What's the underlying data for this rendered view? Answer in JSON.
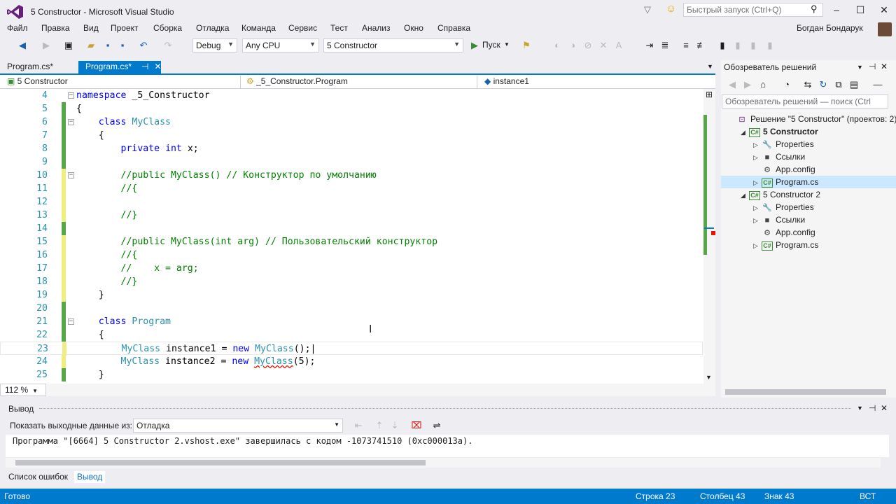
{
  "window": {
    "title": "5 Constructor - Microsoft Visual Studio",
    "quick_launch_placeholder": "Быстрый запуск (Ctrl+Q)",
    "user": "Богдан Бондарук"
  },
  "menu": [
    "Файл",
    "Правка",
    "Вид",
    "Проект",
    "Сборка",
    "Отладка",
    "Команда",
    "Сервис",
    "Тест",
    "Анализ",
    "Окно",
    "Справка"
  ],
  "toolbar": {
    "config": "Debug",
    "platform": "Any CPU",
    "startup_project": "5 Constructor",
    "run_label": "Пуск"
  },
  "tabs": [
    "Program.cs*",
    "Program.cs*"
  ],
  "navbar": {
    "project": "5 Constructor",
    "class": "_5_Constructor.Program",
    "member": "instance1"
  },
  "editor": {
    "zoom": "112 %",
    "lines": [
      {
        "n": "4",
        "parts": [
          [
            "kw",
            "namespace"
          ],
          [
            "p",
            " _5_Constructor"
          ]
        ]
      },
      {
        "n": "5",
        "parts": [
          [
            "p",
            "{"
          ]
        ]
      },
      {
        "n": "6",
        "parts": [
          [
            "p",
            "    "
          ],
          [
            "kw",
            "class"
          ],
          [
            "p",
            " "
          ],
          [
            "ty",
            "MyClass"
          ]
        ]
      },
      {
        "n": "7",
        "parts": [
          [
            "p",
            "    {"
          ]
        ]
      },
      {
        "n": "8",
        "parts": [
          [
            "p",
            "        "
          ],
          [
            "kw",
            "private"
          ],
          [
            "p",
            " "
          ],
          [
            "kw",
            "int"
          ],
          [
            "p",
            " x;"
          ]
        ]
      },
      {
        "n": "9",
        "parts": [
          [
            "p",
            ""
          ]
        ]
      },
      {
        "n": "10",
        "parts": [
          [
            "p",
            "        "
          ],
          [
            "cm",
            "//public MyClass() // Конструктор по умолчанию"
          ]
        ]
      },
      {
        "n": "11",
        "parts": [
          [
            "p",
            "        "
          ],
          [
            "cm",
            "//{"
          ]
        ]
      },
      {
        "n": "12",
        "parts": [
          [
            "p",
            ""
          ]
        ]
      },
      {
        "n": "13",
        "parts": [
          [
            "p",
            "        "
          ],
          [
            "cm",
            "//}"
          ]
        ]
      },
      {
        "n": "14",
        "parts": [
          [
            "p",
            ""
          ]
        ]
      },
      {
        "n": "15",
        "parts": [
          [
            "p",
            "        "
          ],
          [
            "cm",
            "//public MyClass(int arg) // Пользовательский конструктор"
          ]
        ]
      },
      {
        "n": "16",
        "parts": [
          [
            "p",
            "        "
          ],
          [
            "cm",
            "//{"
          ]
        ]
      },
      {
        "n": "17",
        "parts": [
          [
            "p",
            "        "
          ],
          [
            "cm",
            "//    x = arg;"
          ]
        ]
      },
      {
        "n": "18",
        "parts": [
          [
            "p",
            "        "
          ],
          [
            "cm",
            "//}"
          ]
        ]
      },
      {
        "n": "19",
        "parts": [
          [
            "p",
            "    }"
          ]
        ]
      },
      {
        "n": "20",
        "parts": [
          [
            "p",
            ""
          ]
        ]
      },
      {
        "n": "21",
        "parts": [
          [
            "p",
            "    "
          ],
          [
            "kw",
            "class"
          ],
          [
            "p",
            " "
          ],
          [
            "ty",
            "Program"
          ]
        ]
      },
      {
        "n": "22",
        "parts": [
          [
            "p",
            "    {"
          ]
        ]
      },
      {
        "n": "23",
        "parts": [
          [
            "p",
            "        "
          ],
          [
            "ty",
            "MyClass"
          ],
          [
            "p",
            " instance1 = "
          ],
          [
            "kw",
            "new"
          ],
          [
            "p",
            " "
          ],
          [
            "ty",
            "MyClass"
          ],
          [
            "p",
            "();|"
          ]
        ]
      },
      {
        "n": "24",
        "parts": [
          [
            "p",
            "        "
          ],
          [
            "ty",
            "MyClass"
          ],
          [
            "p",
            " instance2 = "
          ],
          [
            "kw",
            "new"
          ],
          [
            "p",
            " "
          ],
          [
            "ty",
            "MyClass"
          ],
          [
            "p",
            "(5);"
          ]
        ]
      },
      {
        "n": "25",
        "parts": [
          [
            "p",
            "    }"
          ]
        ]
      }
    ]
  },
  "solution_explorer": {
    "title": "Обозреватель решений",
    "search_placeholder": "Обозреватель решений — поиск (Ctrl",
    "items": [
      {
        "label": "Решение \"5 Constructor\" (проектов: 2)",
        "level": 0,
        "icon": "solution-icon",
        "exp": ""
      },
      {
        "label": "5 Constructor",
        "level": 1,
        "icon": "csproj-icon",
        "exp": "◢",
        "bold": true
      },
      {
        "label": "Properties",
        "level": 2,
        "icon": "wrench-icon",
        "exp": "▷"
      },
      {
        "label": "Ссылки",
        "level": 2,
        "icon": "references-icon",
        "exp": "▷"
      },
      {
        "label": "App.config",
        "level": 2,
        "icon": "config-icon",
        "exp": ""
      },
      {
        "label": "Program.cs",
        "level": 2,
        "icon": "csfile-icon",
        "exp": "▷"
      },
      {
        "label": "5 Constructor 2",
        "level": 1,
        "icon": "csproj-icon",
        "exp": "◢"
      },
      {
        "label": "Properties",
        "level": 2,
        "icon": "wrench-icon",
        "exp": "▷"
      },
      {
        "label": "Ссылки",
        "level": 2,
        "icon": "references-icon",
        "exp": "▷"
      },
      {
        "label": "App.config",
        "level": 2,
        "icon": "config-icon",
        "exp": ""
      },
      {
        "label": "Program.cs",
        "level": 2,
        "icon": "csfile-icon",
        "exp": "▷"
      }
    ]
  },
  "output": {
    "title": "Вывод",
    "show_from_label": "Показать выходные данные из:",
    "source": "Отладка",
    "text": "Программа \"[6664] 5 Constructor 2.vshost.exe\" завершилась с кодом -1073741510 (0xc000013a)."
  },
  "bottom_tabs": [
    "Список ошибок",
    "Вывод"
  ],
  "status": {
    "ready": "Готово",
    "line": "Строка 23",
    "col": "Столбец 43",
    "ch": "Знак 43",
    "mode": "ВСТ"
  },
  "colors": {
    "accent": "#007acc",
    "keyword": "#0000ff",
    "type": "#2b91af",
    "comment": "#008000"
  }
}
